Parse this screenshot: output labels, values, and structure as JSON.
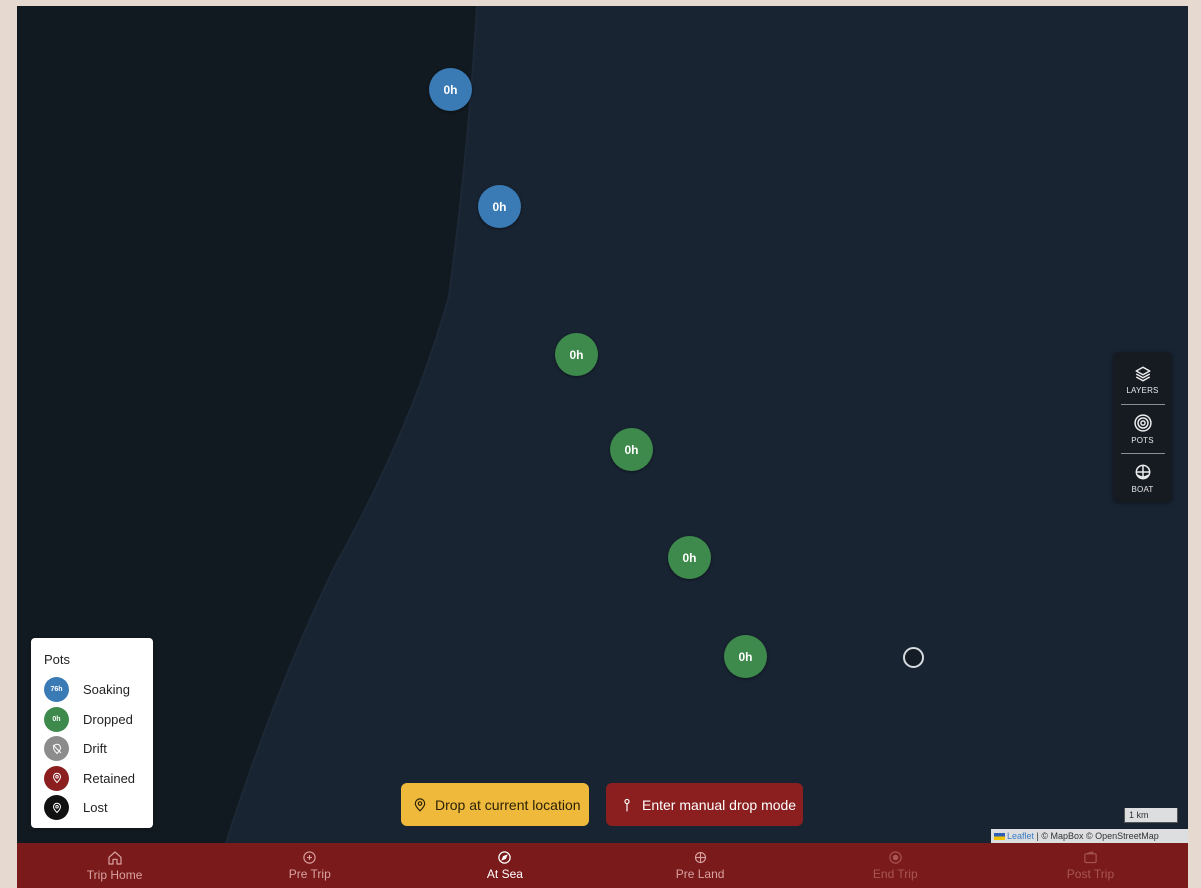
{
  "colors": {
    "sea": "#192433",
    "land": "#121a21",
    "soaking": "#3a7bb5",
    "dropped": "#3d8a4c",
    "drift": "#8c8c8c",
    "retained": "#8b1f1f",
    "lost": "#111111",
    "drop_button": "#efb93c",
    "manual_button": "#8b1f1f",
    "nav_bar": "#7b1a1a"
  },
  "map": {
    "pots": [
      {
        "status": "soaking",
        "label": "0h"
      },
      {
        "status": "soaking",
        "label": "0h"
      },
      {
        "status": "dropped",
        "label": "0h"
      },
      {
        "status": "dropped",
        "label": "0h"
      },
      {
        "status": "dropped",
        "label": "0h"
      },
      {
        "status": "dropped",
        "label": "0h"
      }
    ],
    "scale_label": "1 km",
    "attribution": {
      "leaflet": "Leaflet",
      "rest": "| © MapBox © OpenStreetMap"
    }
  },
  "controls": [
    {
      "label": "LAYERS",
      "icon": "layers-icon"
    },
    {
      "label": "POTS",
      "icon": "pots-icon"
    },
    {
      "label": "BOAT",
      "icon": "boat-icon"
    }
  ],
  "legend": {
    "title": "Pots",
    "items": [
      {
        "label": "Soaking",
        "badge": "76h",
        "icon": "soaking-badge"
      },
      {
        "label": "Dropped",
        "badge": "0h",
        "icon": "dropped-badge"
      },
      {
        "label": "Drift",
        "badge": "",
        "icon": "drift-icon"
      },
      {
        "label": "Retained",
        "badge": "",
        "icon": "retained-icon"
      },
      {
        "label": "Lost",
        "badge": "",
        "icon": "lost-icon"
      }
    ]
  },
  "actions": {
    "drop_current": "Drop at current location",
    "manual_drop": "Enter manual drop mode"
  },
  "nav": [
    {
      "label": "Trip Home",
      "icon": "home-icon",
      "state": "dim"
    },
    {
      "label": "Pre Trip",
      "icon": "plus-circle-icon",
      "state": "dim"
    },
    {
      "label": "At Sea",
      "icon": "compass-icon",
      "state": "active"
    },
    {
      "label": "Pre Land",
      "icon": "ship-wheel-icon",
      "state": "dim"
    },
    {
      "label": "End Trip",
      "icon": "stop-circle-icon",
      "state": "disabled"
    },
    {
      "label": "Post Trip",
      "icon": "wallet-icon",
      "state": "disabled"
    }
  ]
}
